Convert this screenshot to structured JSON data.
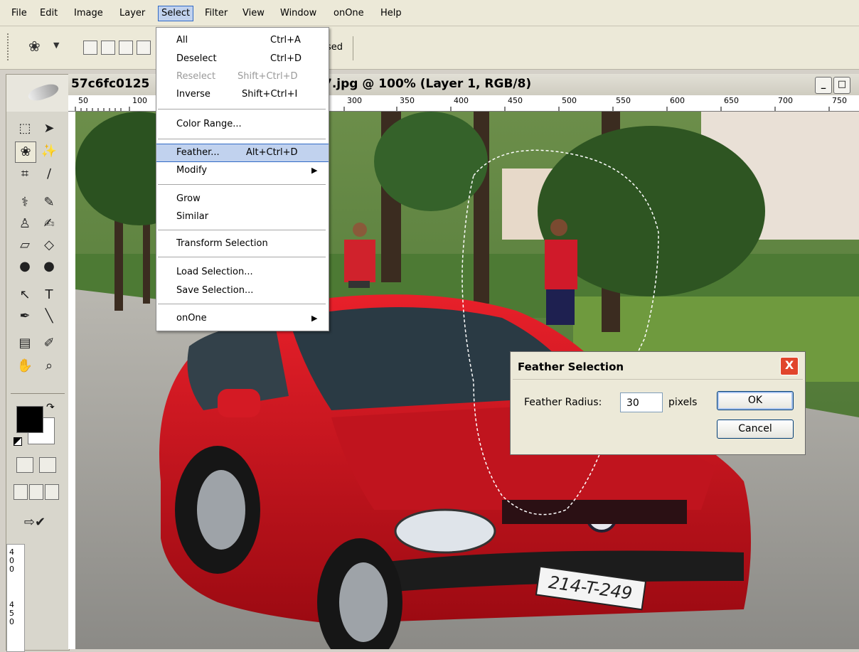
{
  "menubar": {
    "items": [
      "File",
      "Edit",
      "Image",
      "Layer",
      "Select",
      "Filter",
      "View",
      "Window",
      "onOne",
      "Help"
    ],
    "active": "Select"
  },
  "options_bar": {
    "partial_label": "sed"
  },
  "document": {
    "title_left": "57c6fc0125",
    "title_right": "7.jpg @ 100% (Layer 1, RGB/8)",
    "ruler_ticks": [
      "50",
      "100",
      "300",
      "350",
      "400",
      "450",
      "500",
      "550",
      "600",
      "650",
      "700",
      "750"
    ],
    "vruler_ticks": [
      "4",
      "0",
      "0",
      "4",
      "5",
      "0"
    ],
    "plate_text": "214-T-249"
  },
  "select_menu": {
    "items": [
      {
        "label": "All",
        "shortcut": "Ctrl+A"
      },
      {
        "label": "Deselect",
        "shortcut": "Ctrl+D"
      },
      {
        "label": "Reselect",
        "shortcut": "Shift+Ctrl+D"
      },
      {
        "label": "Inverse",
        "shortcut": "Shift+Ctrl+I"
      },
      {
        "label": "Color Range..."
      },
      {
        "label": "Feather...",
        "shortcut": "Alt+Ctrl+D"
      },
      {
        "label": "Modify",
        "arrow": "▶"
      },
      {
        "label": "Grow"
      },
      {
        "label": "Similar"
      },
      {
        "label": "Transform Selection"
      },
      {
        "label": "Load Selection..."
      },
      {
        "label": "Save Selection..."
      },
      {
        "label": "onOne",
        "arrow": "▶"
      }
    ]
  },
  "feather_dialog": {
    "title": "Feather Selection",
    "label": "Feather Radius:",
    "value": "30",
    "unit": "pixels",
    "ok": "OK",
    "cancel": "Cancel",
    "close": "X"
  },
  "colors": {
    "accent": "#316ac5",
    "car": "#c4101a",
    "foreground": "#000000",
    "background": "#ffffff"
  }
}
